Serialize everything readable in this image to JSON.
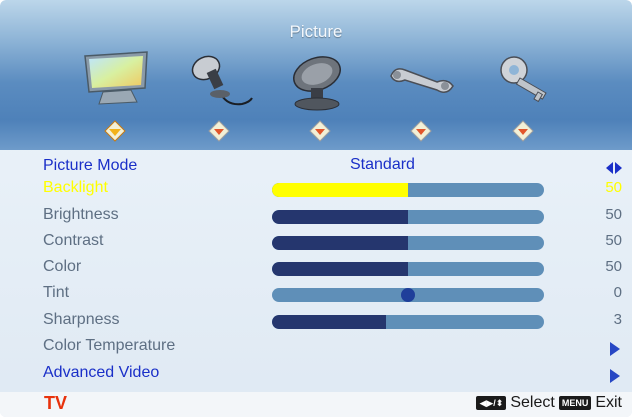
{
  "menu": {
    "title": "Picture",
    "icons": [
      {
        "name": "picture-monitor-icon"
      },
      {
        "name": "audio-microphone-icon"
      },
      {
        "name": "satellite-dish-icon"
      },
      {
        "name": "settings-wrench-icon"
      },
      {
        "name": "key-icon"
      }
    ]
  },
  "colors": {
    "accent_selected": "#ffff00",
    "label_primary": "#1a2fc8",
    "label_inactive": "#5e6f83",
    "bar_fill": "#25366e",
    "bar_track": "#5f8fb8",
    "tv_label": "#e8320c"
  },
  "rows": [
    {
      "label": "Picture Mode",
      "value": "Standard",
      "type": "mode"
    },
    {
      "label": "Backlight",
      "value": "50",
      "type": "bar",
      "level": 0.5
    },
    {
      "label": "Brightness",
      "value": "50",
      "type": "bar",
      "level": 0.5
    },
    {
      "label": "Contrast",
      "value": "50",
      "type": "bar",
      "level": 0.5
    },
    {
      "label": "Color",
      "value": "50",
      "type": "bar",
      "level": 0.5
    },
    {
      "label": "Tint",
      "value": "0",
      "type": "tint",
      "level": 0.5
    },
    {
      "label": "Sharpness",
      "value": "3",
      "type": "bar",
      "level": 0.42
    },
    {
      "label": "Color Temperature",
      "type": "submenu"
    },
    {
      "label": "Advanced Video",
      "type": "submenu"
    }
  ],
  "footer": {
    "source": "TV",
    "select_key": "◀▶/⬍",
    "select_label": "Select",
    "menu_key": "MENU",
    "exit_label": "Exit"
  }
}
